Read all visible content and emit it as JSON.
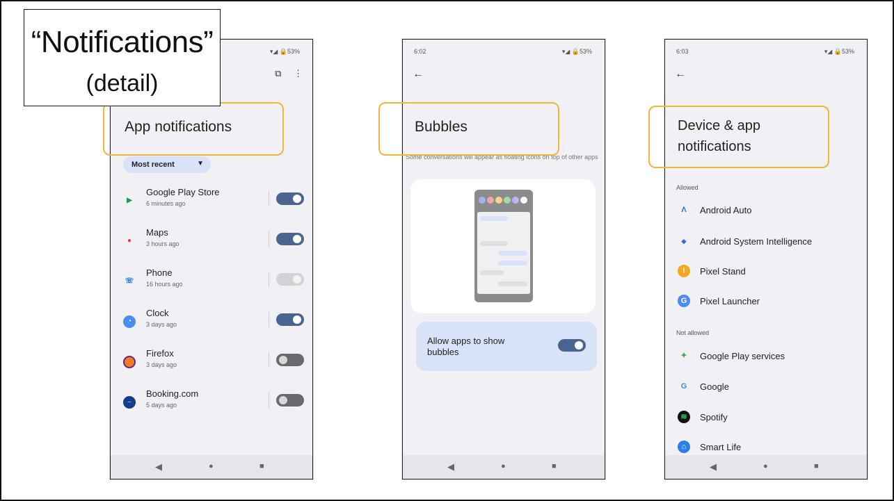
{
  "slide": {
    "title": "“Notifications”",
    "subtitle": "(detail)"
  },
  "phone1": {
    "status_right": "▾◢ 🔒53%",
    "heading": "App notifications",
    "sort_chip": "Most recent",
    "apps": [
      {
        "name": "Google Play Store",
        "time": "6 minutes ago",
        "toggle": "on",
        "icon": "google-play-icon",
        "color": "#ffffff"
      },
      {
        "name": "Maps",
        "time": "3 hours ago",
        "toggle": "on",
        "icon": "maps-icon",
        "color": "#ffffff"
      },
      {
        "name": "Phone",
        "time": "16 hours ago",
        "toggle": "dim",
        "icon": "phone-icon",
        "color": "#ffffff"
      },
      {
        "name": "Clock",
        "time": "3 days ago",
        "toggle": "on",
        "icon": "clock-icon",
        "color": "#4a8cf0"
      },
      {
        "name": "Firefox",
        "time": "3 days ago",
        "toggle": "off",
        "icon": "firefox-icon",
        "color": "#f37a1f"
      },
      {
        "name": "Booking.com",
        "time": "5 days ago",
        "toggle": "off",
        "icon": "booking-icon",
        "color": "#143c8c"
      }
    ]
  },
  "phone2": {
    "time": "6:02",
    "status_right": "▾◢ 🔒53%",
    "heading": "Bubbles",
    "description": "Some conversations will appear as floating icons on top of other apps",
    "toggle_label": "Allow apps to show bubbles",
    "toggle_state": "on"
  },
  "phone3": {
    "time": "6:03",
    "status_right": "▾◢ 🔒53%",
    "heading": "Device & app notifications",
    "allowed_label": "Allowed",
    "allowed": [
      {
        "name": "Android Auto",
        "icon": "android-auto-icon"
      },
      {
        "name": "Android System Intelligence",
        "icon": "android-system-intelligence-icon"
      },
      {
        "name": "Pixel Stand",
        "icon": "pixel-stand-icon"
      },
      {
        "name": "Pixel Launcher",
        "icon": "pixel-launcher-icon"
      }
    ],
    "not_allowed_label": "Not allowed",
    "not_allowed": [
      {
        "name": "Google Play services",
        "icon": "google-play-services-icon"
      },
      {
        "name": "Google",
        "icon": "google-icon"
      },
      {
        "name": "Spotify",
        "icon": "spotify-icon"
      },
      {
        "name": "Smart Life",
        "icon": "smart-life-icon"
      }
    ]
  },
  "navbar": {
    "back": "◀",
    "home": "●",
    "recents": "■"
  },
  "colors": {
    "highlight": "#f2b53a",
    "toggle_on": "#4a6690",
    "chip": "#d8e3f9",
    "background": "#f1f0f5"
  }
}
